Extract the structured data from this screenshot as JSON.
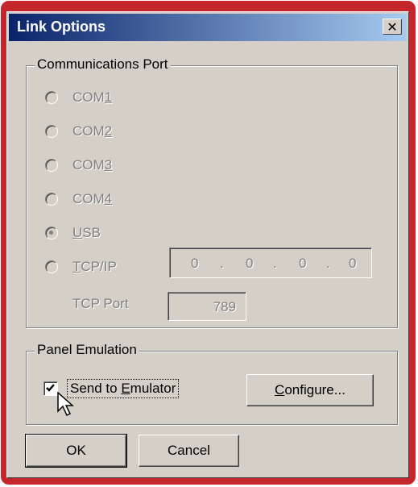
{
  "window": {
    "title": "Link Options",
    "close_glyph": "✕"
  },
  "comm_port": {
    "legend": "Communications Port",
    "options": [
      {
        "label": "COM",
        "mnemonic": "1",
        "selected": false
      },
      {
        "label": "COM",
        "mnemonic": "2",
        "selected": false
      },
      {
        "label": "COM",
        "mnemonic": "3",
        "selected": false
      },
      {
        "label": "COM",
        "mnemonic": "4",
        "selected": false
      },
      {
        "label": "",
        "mnemonic": "U",
        "rest": "SB",
        "selected": true
      },
      {
        "label": "",
        "mnemonic": "T",
        "rest": "CP/IP",
        "selected": false
      }
    ],
    "ip_octets": [
      "0",
      ".",
      "0",
      ".",
      "0",
      ".",
      "0"
    ],
    "tcp_port_label": "TCP Port",
    "tcp_port_value": "789"
  },
  "panel_emulation": {
    "legend": "Panel Emulation",
    "send_label_pre": "Send to ",
    "send_label_mn": "E",
    "send_label_post": "mulator",
    "send_checked": true,
    "configure_mn": "C",
    "configure_rest": "onfigure..."
  },
  "buttons": {
    "ok": "OK",
    "cancel": "Cancel"
  },
  "colors": {
    "frame": "#c3262b",
    "dialog_bg": "#d4d0c8",
    "title_start": "#0a246a",
    "title_end": "#a6caf0"
  }
}
